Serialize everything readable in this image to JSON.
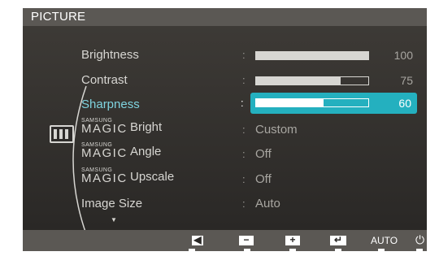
{
  "header": {
    "title": "PICTURE"
  },
  "menu": {
    "items": [
      {
        "label": "Brightness",
        "type": "slider",
        "value": 100,
        "max": 100
      },
      {
        "label": "Contrast",
        "type": "slider",
        "value": 75,
        "max": 100
      },
      {
        "label": "Sharpness",
        "type": "slider",
        "value": 60,
        "max": 100,
        "selected": true
      },
      {
        "prefix_small": "SAMSUNG",
        "prefix": "MAGIC",
        "label": "Bright",
        "value": "Custom"
      },
      {
        "prefix_small": "SAMSUNG",
        "prefix": "MAGIC",
        "label": "Angle",
        "value": "Off"
      },
      {
        "prefix_small": "SAMSUNG",
        "prefix": "MAGIC",
        "label": "Upscale",
        "value": "Off"
      },
      {
        "label": "Image Size",
        "value": "Auto"
      }
    ],
    "separator": ":",
    "more_indicator": "▼"
  },
  "footer": {
    "buttons": [
      {
        "icon": "left-arrow-icon",
        "glyph": "◀"
      },
      {
        "icon": "minus-icon",
        "glyph": "−"
      },
      {
        "icon": "plus-icon",
        "glyph": "+"
      },
      {
        "icon": "enter-icon",
        "glyph": "↵"
      },
      {
        "icon": "auto-label",
        "label": "AUTO"
      },
      {
        "icon": "power-icon",
        "glyph": "⏻"
      }
    ]
  },
  "colors": {
    "accent": "#24b0bf",
    "active_text": "#7fd4e0",
    "panel": "#3d3a36",
    "header": "#5b5854"
  }
}
